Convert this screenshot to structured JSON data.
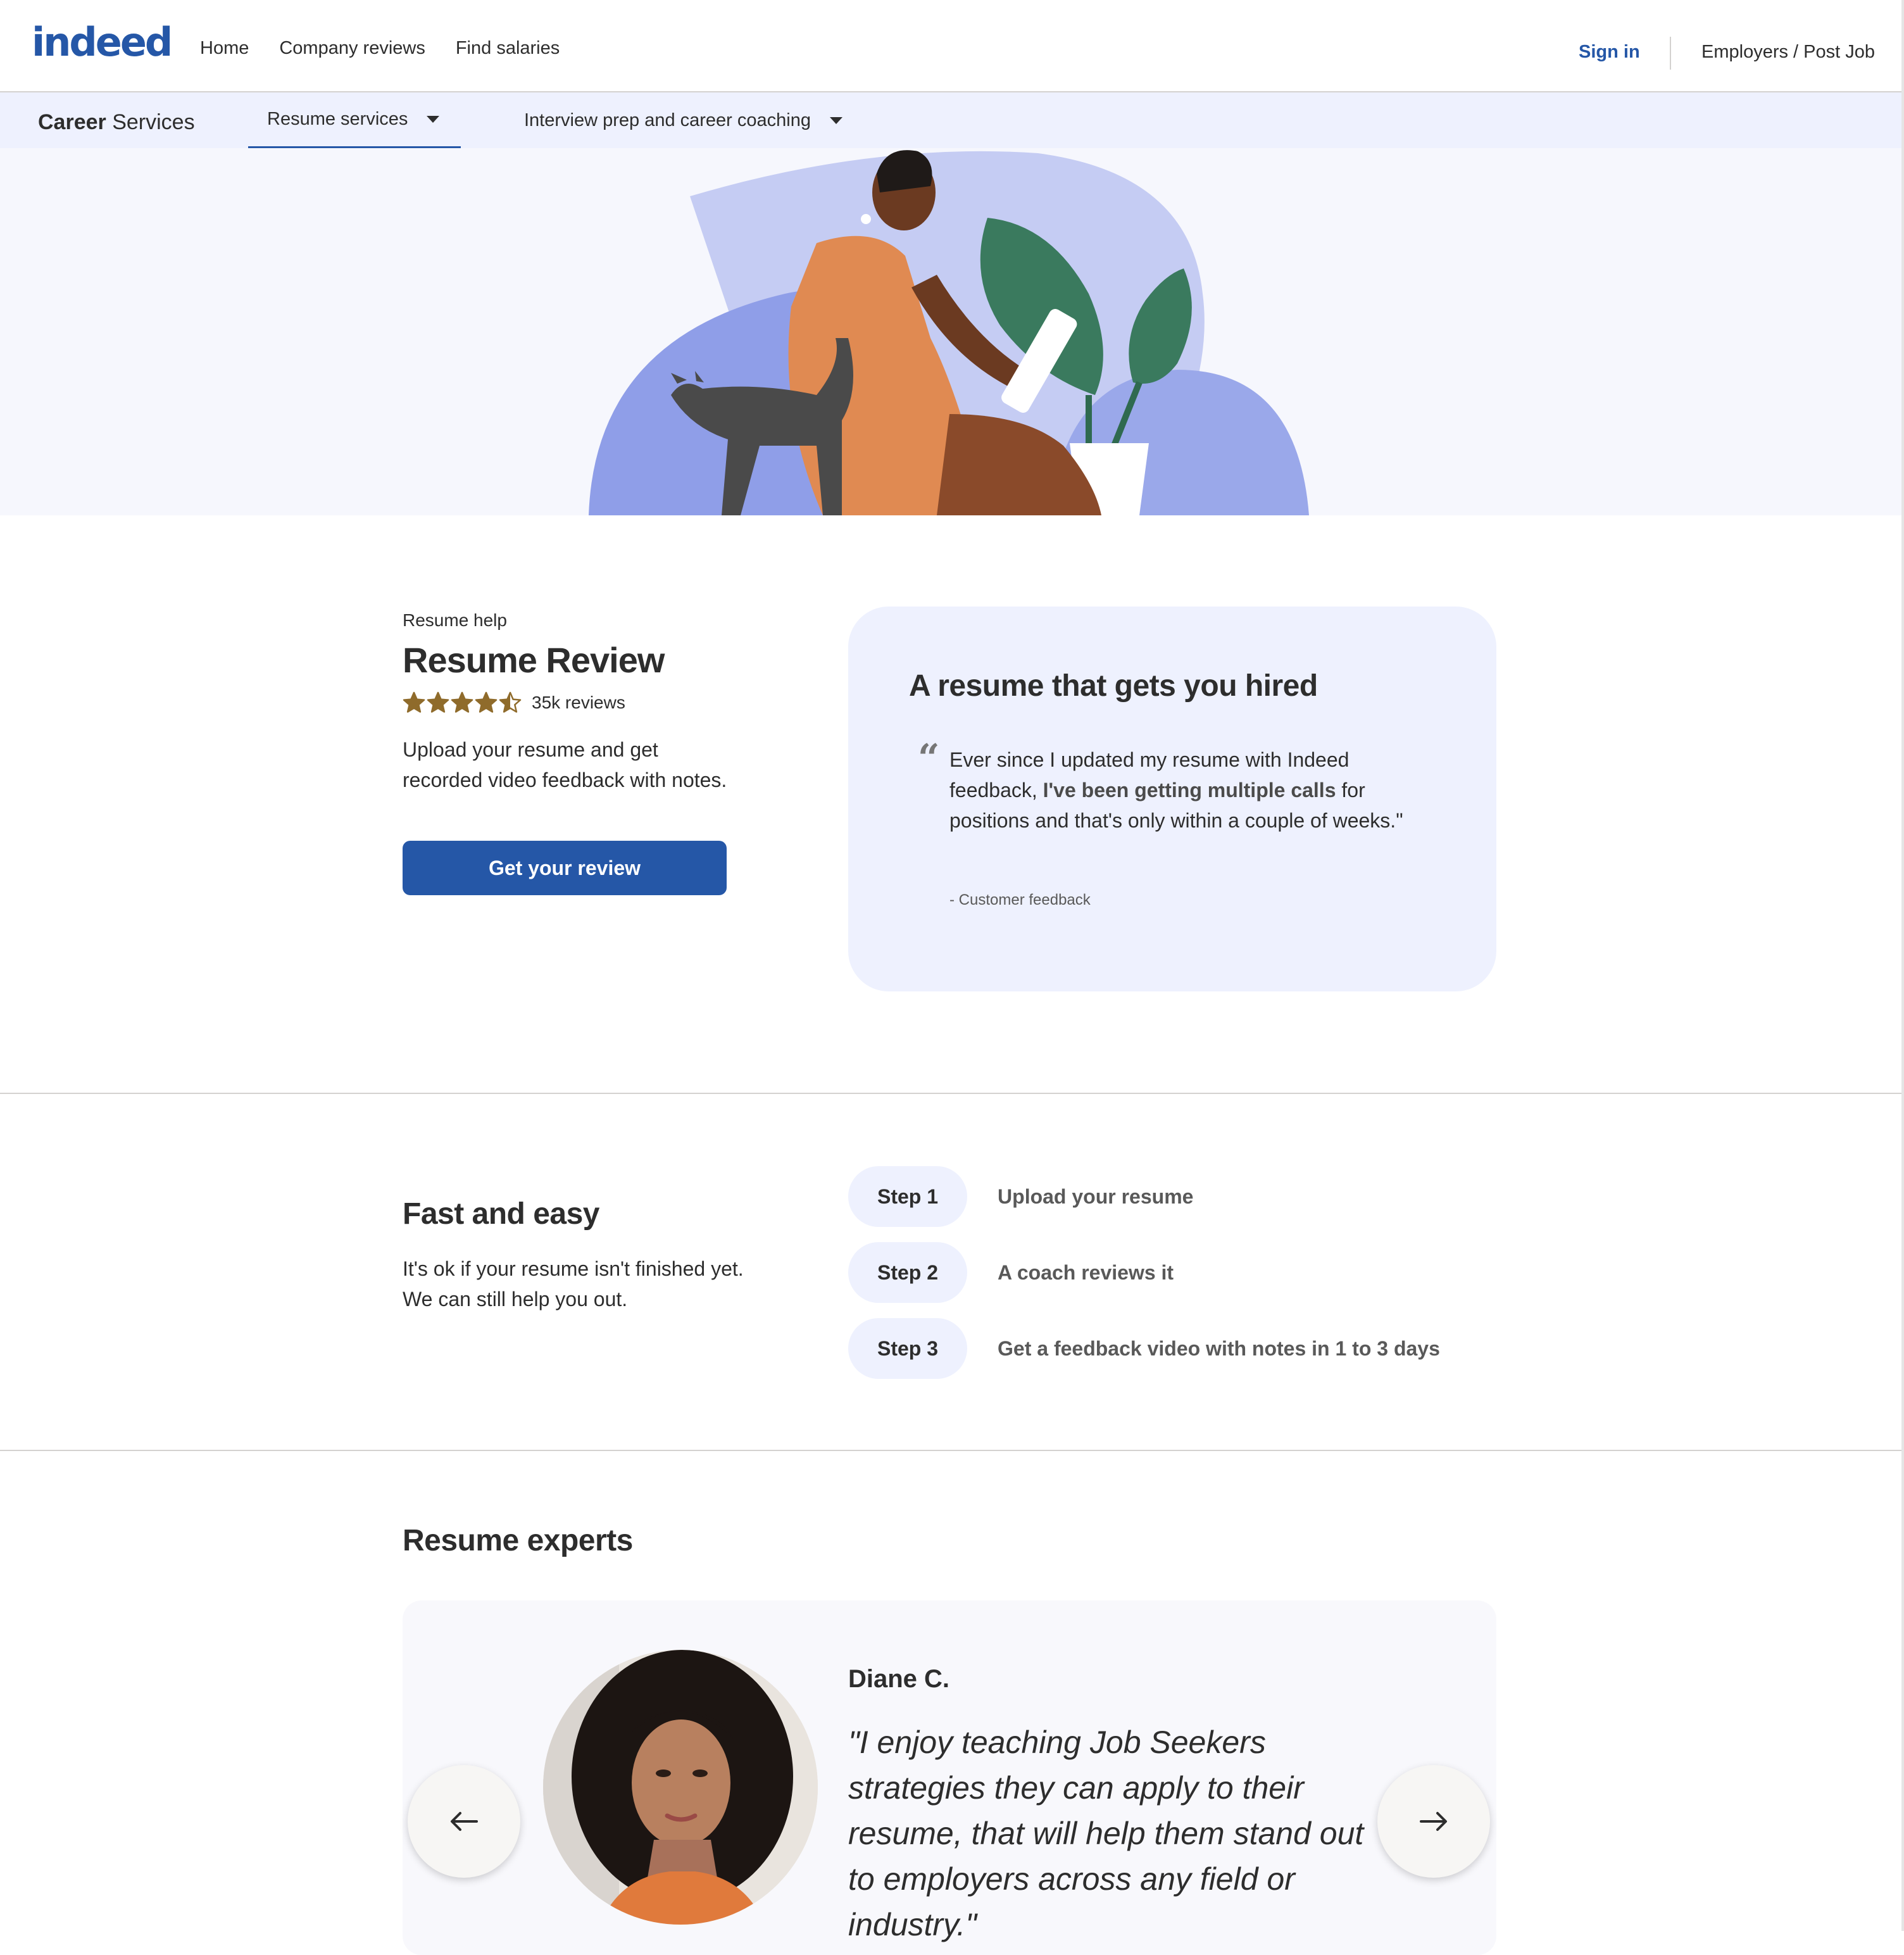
{
  "header": {
    "logo": "indeed",
    "nav": [
      "Home",
      "Company reviews",
      "Find salaries"
    ],
    "sign_in": "Sign in",
    "employers": "Employers / Post Job"
  },
  "subnav": {
    "title_bold": "Career",
    "title_rest": " Services",
    "tabs": [
      {
        "label": "Resume services",
        "active": true
      },
      {
        "label": "Interview prep and career coaching",
        "active": false
      }
    ]
  },
  "resume_review": {
    "eyebrow": "Resume help",
    "title": "Resume Review",
    "rating": 4.5,
    "reviews": "35k reviews",
    "description": "Upload your resume and get recorded video feedback with notes.",
    "cta": "Get your review"
  },
  "quote_card": {
    "title": "A resume that gets you hired",
    "quote_part1": "Ever since I updated my resume with Indeed feedback, ",
    "quote_bold": "I've been getting multiple calls",
    "quote_part2": " for positions and that's only within a couple of weeks.\"",
    "source": "- Customer feedback"
  },
  "fast_easy": {
    "title": "Fast and easy",
    "description": "It's ok if your resume isn't finished yet. We can still help you out.",
    "steps": [
      {
        "label": "Step 1",
        "text": "Upload your resume"
      },
      {
        "label": "Step 2",
        "text": "A coach reviews it"
      },
      {
        "label": "Step 3",
        "text": "Get a feedback video with notes in 1 to 3 days"
      }
    ]
  },
  "experts": {
    "title": "Resume experts",
    "name": "Diane C.",
    "quote": "\"I enjoy teaching Job Seekers strategies they can apply to their resume, that will help them stand out to employers across any field or industry.\""
  },
  "colors": {
    "brand_blue": "#2557a7",
    "lavender_bg": "#eef1fe",
    "star_gold": "#8f6b2b"
  },
  "icons": [
    "quote-icon",
    "star-icon",
    "arrow-left-icon",
    "arrow-right-icon",
    "caret-down-icon"
  ]
}
